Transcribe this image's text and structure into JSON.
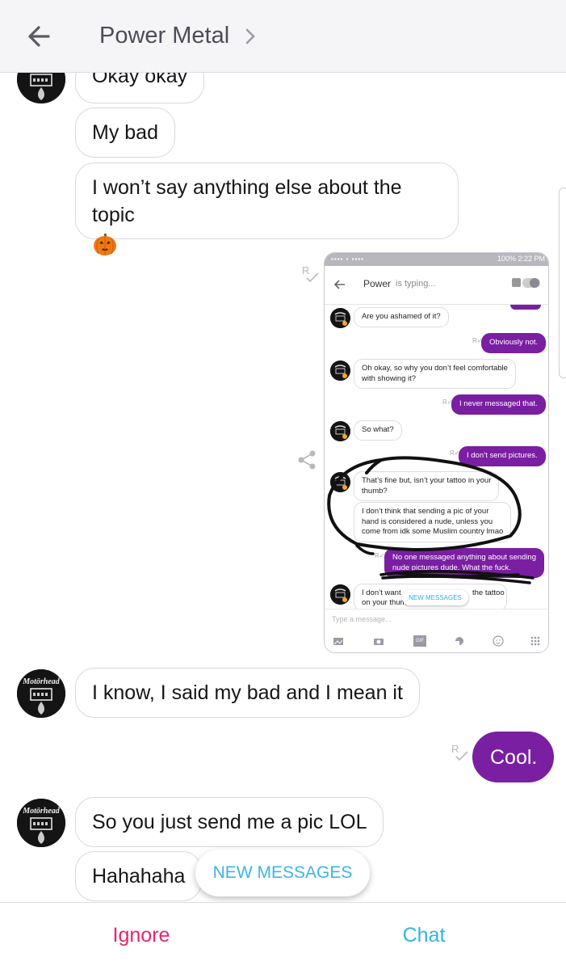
{
  "header": {
    "title": "Power Metal",
    "back_icon": "arrow-left-icon",
    "chevron_icon": "chevron-right-icon"
  },
  "messages": [
    {
      "from": "them",
      "text": "Okay okay"
    },
    {
      "from": "them",
      "text": "My bad"
    },
    {
      "from": "them",
      "text": "I won’t say anything else about the topic",
      "emoji": "jack-o-lantern"
    },
    {
      "from": "me",
      "type": "image"
    },
    {
      "from": "them",
      "text": "I know, I said my bad and I mean it"
    },
    {
      "from": "me",
      "text": "Cool."
    },
    {
      "from": "them",
      "text": "So you just send me a pic LOL"
    },
    {
      "from": "them",
      "text": "Hahahaha"
    }
  ],
  "screenshot": {
    "status_battery": "100%",
    "status_time": "2:22 PM",
    "contact_name": "Power",
    "typing_text": "is typing...",
    "messages": [
      {
        "from": "them",
        "text": "Are you ashamed of it?"
      },
      {
        "from": "me",
        "text": "Obviously not."
      },
      {
        "from": "them",
        "lines": [
          "Oh okay, so why you don’t feel comfortable",
          "with showing it?"
        ]
      },
      {
        "from": "me",
        "text": "I never messaged that."
      },
      {
        "from": "them",
        "text": "So what?"
      },
      {
        "from": "me",
        "text": "I don’t send pictures."
      },
      {
        "from": "them",
        "lines": [
          "That’s fine but, isn’t your tattoo in your",
          "thumb?"
        ]
      },
      {
        "from": "them",
        "lines": [
          "I don’t think that sending a pic of your",
          "hand is considered a nude, unless you",
          "come from idk some Muslim country lmao"
        ]
      },
      {
        "from": "me",
        "lines": [
          "No one messaged anything about sending",
          "nude pictures dude. What the fuck."
        ]
      },
      {
        "from": "them",
        "lines": [
          "I don’t want",
          "the tattoo",
          "on your thumb"
        ]
      }
    ],
    "new_messages": "NEW MESSAGES",
    "input_placeholder": "Type a message...",
    "gif_label": "GIF"
  },
  "new_messages_pill": "NEW MESSAGES",
  "actions": {
    "ignore": "Ignore",
    "chat": "Chat"
  },
  "colors": {
    "accent_purple": "#7a1fa2",
    "ignore_pink": "#e8256b",
    "chat_blue": "#35b4e3",
    "header_bg": "#f5f5f7"
  }
}
